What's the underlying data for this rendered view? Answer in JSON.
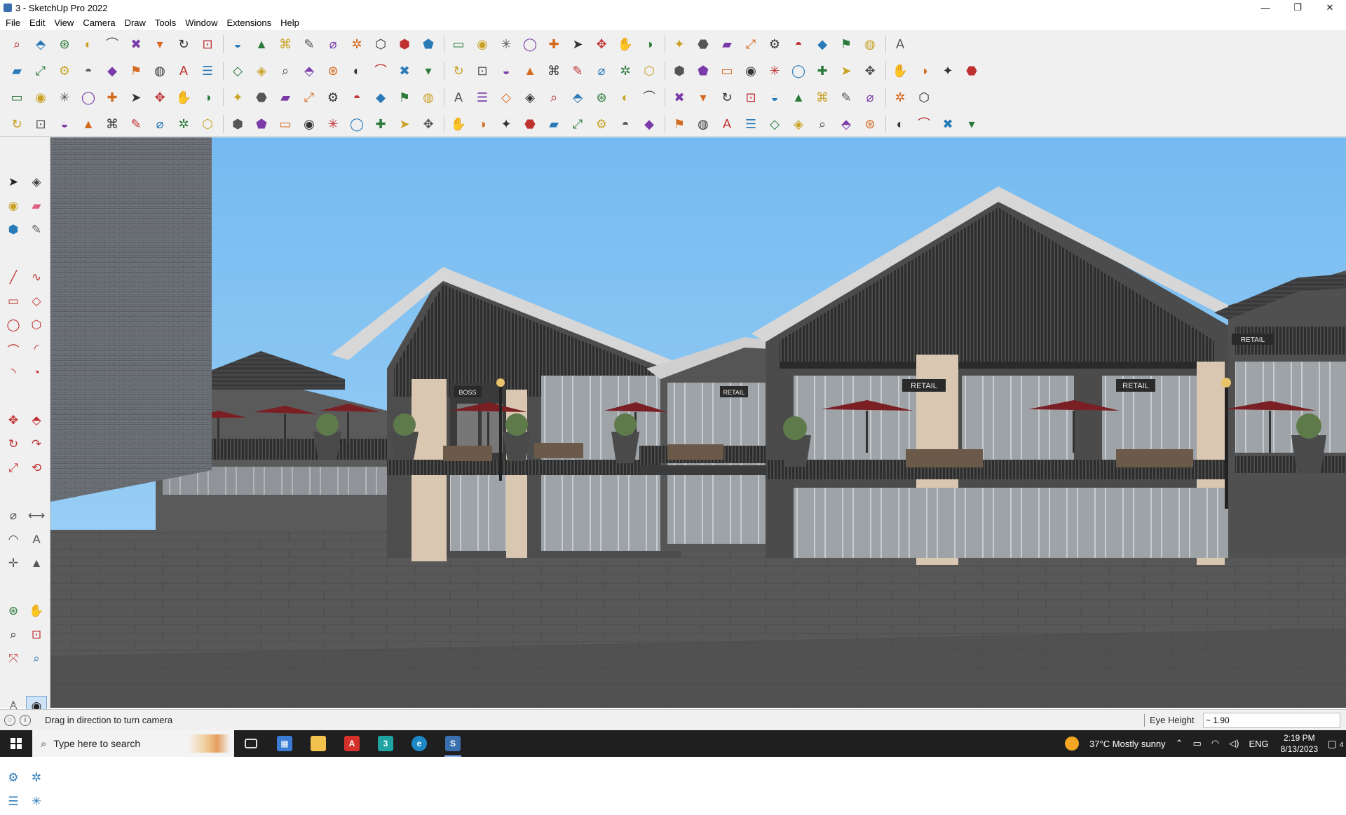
{
  "window": {
    "title": "3 - SketchUp Pro 2022",
    "minimize": "—",
    "restore": "❐",
    "close": "✕"
  },
  "menu": [
    "File",
    "Edit",
    "View",
    "Camera",
    "Draw",
    "Tools",
    "Window",
    "Extensions",
    "Help"
  ],
  "toolbars": {
    "row1": [
      "zoom-icon",
      "select-arrow-icon",
      "dropdown-icon",
      "eraser-icon",
      "pencil-icon",
      "dropdown-icon",
      "freehand-icon",
      "dropdown-icon",
      "rectangle-icon",
      "dropdown-icon",
      "push-pull-icon",
      "follow-me-icon",
      "move-icon",
      "rotate-icon",
      "scale-icon",
      "tape-measure-icon",
      "text-icon",
      "paint-bucket-icon",
      "orbit-icon",
      "pan-icon",
      "zoom-tool-icon",
      "zoom-extents-icon",
      "model-info-icon",
      "components-icon",
      "layers-icon",
      "styles-icon",
      "user-icon",
      "dropdown-icon",
      "warehouse-icon",
      "extension-warehouse-icon",
      "sections-icon",
      "solid-tools-icon",
      "flip-icon",
      "xray-icon",
      "undo-icon",
      "redo-icon",
      "ruby-icon"
    ],
    "row2": [
      "iso-view-icon",
      "top-view-icon",
      "front-view-icon",
      "push-icon",
      "move-axis-icon",
      "align-icon",
      "dimension-icon",
      "rotate-axis-icon",
      "scale-axis-icon",
      "offset-icon",
      "section-plane-icon",
      "section-cut-icon",
      "section-fill-icon",
      "terrain-icon",
      "sandbox-icon",
      "house-icon",
      "roof-icon",
      "house-outline-icon",
      "building-icon",
      "home-icon",
      "group-icon",
      "curve-icon",
      "leaf-icon",
      "ruler-icon",
      "square-icon",
      "circle-icon",
      "hexagon-icon",
      "ellipse-icon",
      "parallelogram-icon",
      "arc-icon",
      "spiral-icon",
      "lasso-icon",
      "polygon-icon",
      "target-icon",
      "line-icon",
      "ghost-icon",
      "shape1-icon",
      "shape2-icon",
      "shape3-icon",
      "shape4-icon",
      "shape5-icon",
      "shape6-icon"
    ],
    "row3": [
      "blue-shape-icon",
      "blue-plane-icon",
      "yellow-plane-icon",
      "red-plane-icon",
      "green-plane-icon",
      "grid-plane-icon",
      "loop-icon",
      "red-box-icon",
      "list-icon",
      "flag-icon",
      "box-icon",
      "link-icon",
      "corner-icon",
      "dots-icon",
      "plus-red-icon",
      "plus-green-icon",
      "cross-icon",
      "cone-icon",
      "sphere-icon",
      "triangle-icon",
      "horseshoe-icon",
      "knot-icon",
      "cycle-icon",
      "compass-icon",
      "cylinder-icon",
      "hook-icon",
      "network-icon",
      "joint-icon",
      "cluster-icon",
      "cube-icon",
      "mesh-icon",
      "frame-icon",
      "tile1-icon",
      "tile2-icon",
      "tile3-icon",
      "scatter-icon",
      "curve-dots-icon",
      "grid-dots-icon"
    ],
    "row4": [
      "trace-icon",
      "bezier-icon",
      "paint-path-icon",
      "split-icon",
      "gear-icon",
      "shell-icon",
      "spring-icon",
      "torus-icon",
      "blob-icon",
      "fan-icon",
      "corner2-icon",
      "corner3-icon",
      "edge-icon",
      "fillet-icon",
      "stair-icon",
      "wave-icon",
      "helix-icon",
      "comb-icon",
      "hand-icon",
      "leaf2-icon",
      "arrow-icon",
      "lines-icon",
      "ramp-icon",
      "rake-icon",
      "brush-icon",
      "hatch1-icon",
      "hatch2-icon",
      "hatch3-icon",
      "hatch4-icon",
      "hatch5-icon",
      "hatch6-icon",
      "hatch7-icon",
      "hatch8-icon",
      "hatch9-icon",
      "hatch10-icon",
      "hatch11-icon",
      "hatch12-icon",
      "hatch13-icon",
      "hatch14-icon",
      "hatch15-icon"
    ]
  },
  "status": {
    "hint": "Drag in direction to turn camera",
    "vcb_label": "Eye Height",
    "vcb_value": "~ 1.90"
  },
  "scene": {
    "retail_sign": "RETAIL",
    "boss_sign": "BOSS"
  },
  "taskbar": {
    "search_placeholder": "Type here to search",
    "weather": "37°C  Mostly sunny",
    "language": "ENG",
    "time": "2:19 PM",
    "date": "8/13/2023",
    "notification_count": "4"
  },
  "colors": {
    "sky": "#7fbff0",
    "ground": "#555555",
    "umbrella": "#7a1f24",
    "toolbar_bg": "#f0f0f0",
    "taskbar_bg": "#1f1f1f"
  }
}
